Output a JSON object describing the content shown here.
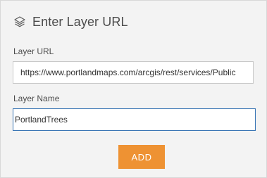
{
  "header": {
    "icon": "layers-icon",
    "title": "Enter Layer URL"
  },
  "form": {
    "url_label": "Layer URL",
    "url_value": "https://www.portlandmaps.com/arcgis/rest/services/Public",
    "name_label": "Layer Name",
    "name_value": "PortlandTrees",
    "add_label": "ADD"
  },
  "colors": {
    "accent": "#ee9233",
    "focus_border": "#3a76b5",
    "panel_bg": "#f3f3f3"
  }
}
